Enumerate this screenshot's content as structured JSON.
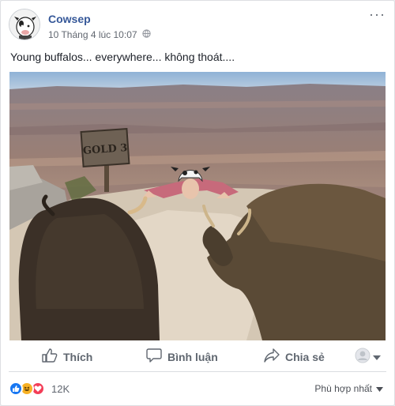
{
  "post": {
    "author": "Cowsep",
    "timestamp": "10 Tháng 4 lúc 10:07",
    "privacy_icon": "globe-icon",
    "text": "Young buffalos... everywhere... không thoát....",
    "image": {
      "sign_text": "GOLD 3"
    }
  },
  "actions": {
    "like_label": "Thích",
    "comment_label": "Bình luận",
    "share_label": "Chia sẻ"
  },
  "reactions": {
    "count": "12K",
    "types": [
      "like-icon",
      "haha-icon",
      "love-icon"
    ],
    "colors": {
      "like": "#1877f2",
      "haha": "#f7b125",
      "love": "#f33e58"
    }
  },
  "sort": {
    "label": "Phù hợp nhất"
  }
}
